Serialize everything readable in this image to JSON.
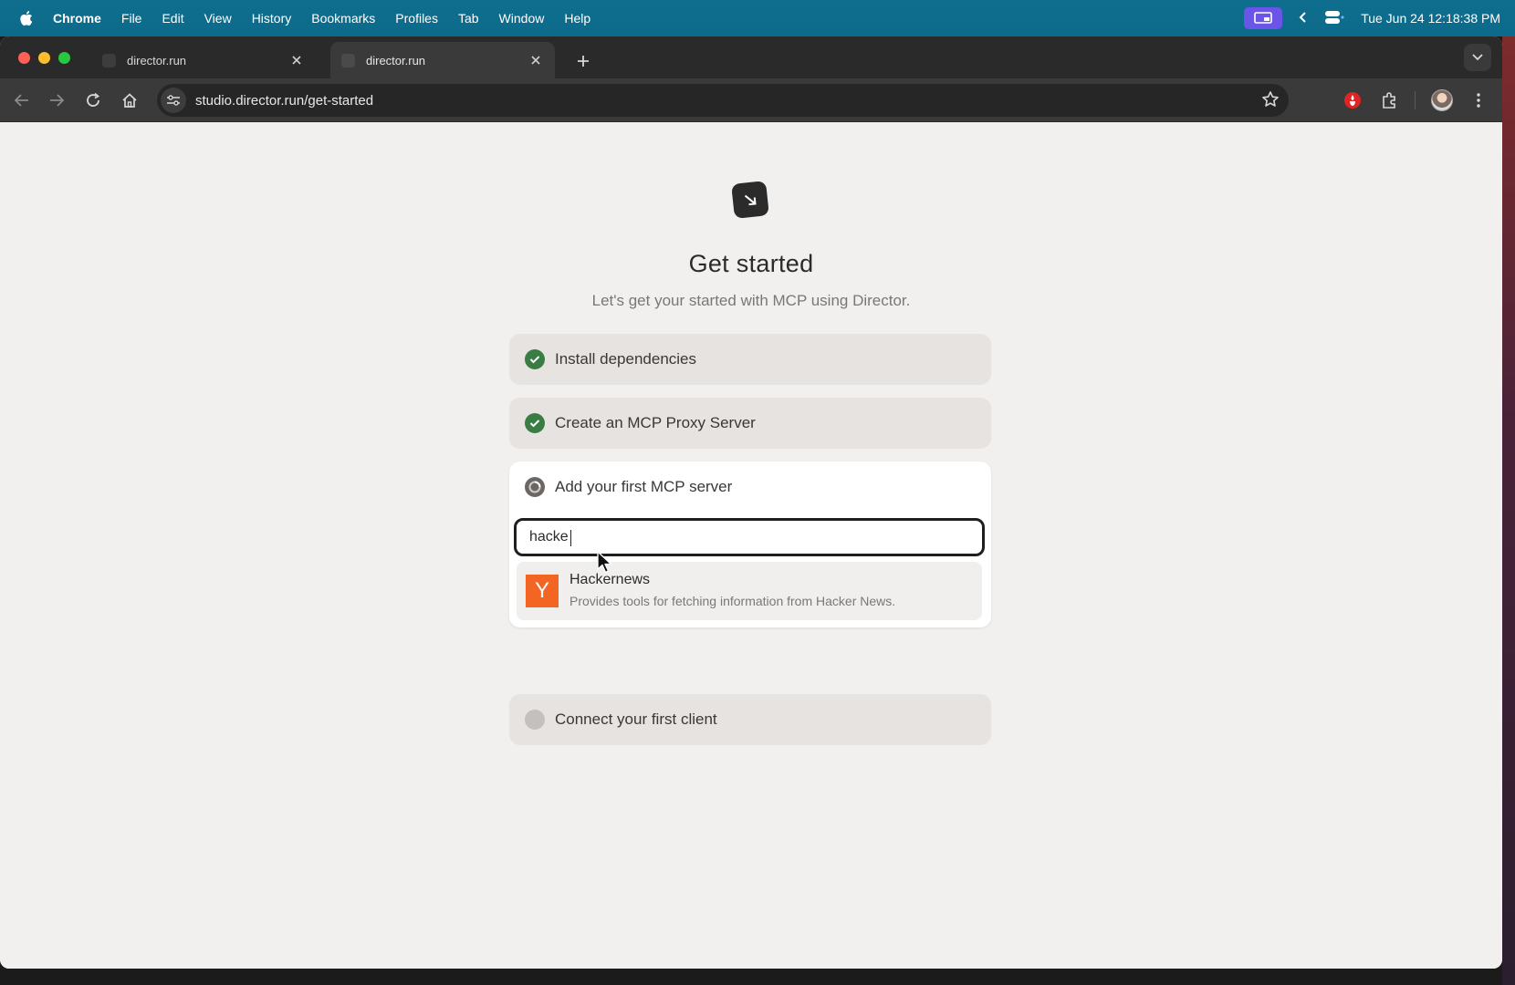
{
  "menubar": {
    "app": "Chrome",
    "items": [
      "File",
      "Edit",
      "View",
      "History",
      "Bookmarks",
      "Profiles",
      "Tab",
      "Window",
      "Help"
    ],
    "datetime": "Tue Jun 24  12:18:38 PM"
  },
  "tabs": [
    {
      "title": "director.run",
      "active": false
    },
    {
      "title": "director.run",
      "active": true
    }
  ],
  "address_bar": {
    "url": "studio.director.run/get-started"
  },
  "page": {
    "title": "Get started",
    "subtitle": "Let's get your started with MCP using Director.",
    "steps": [
      {
        "label": "Install dependencies",
        "status": "done"
      },
      {
        "label": "Create an MCP Proxy Server",
        "status": "done"
      },
      {
        "label": "Add your first MCP server",
        "status": "in-progress"
      },
      {
        "label": "Connect your first client",
        "status": "pending"
      }
    ],
    "search": {
      "value": "hacke"
    },
    "result": {
      "logo_letter": "Y",
      "name": "Hackernews",
      "description": "Provides tools for fetching information from Hacker News."
    }
  },
  "colors": {
    "menubar": "#0f6e8e",
    "done": "#3a7d44",
    "hn_orange": "#f26522"
  }
}
